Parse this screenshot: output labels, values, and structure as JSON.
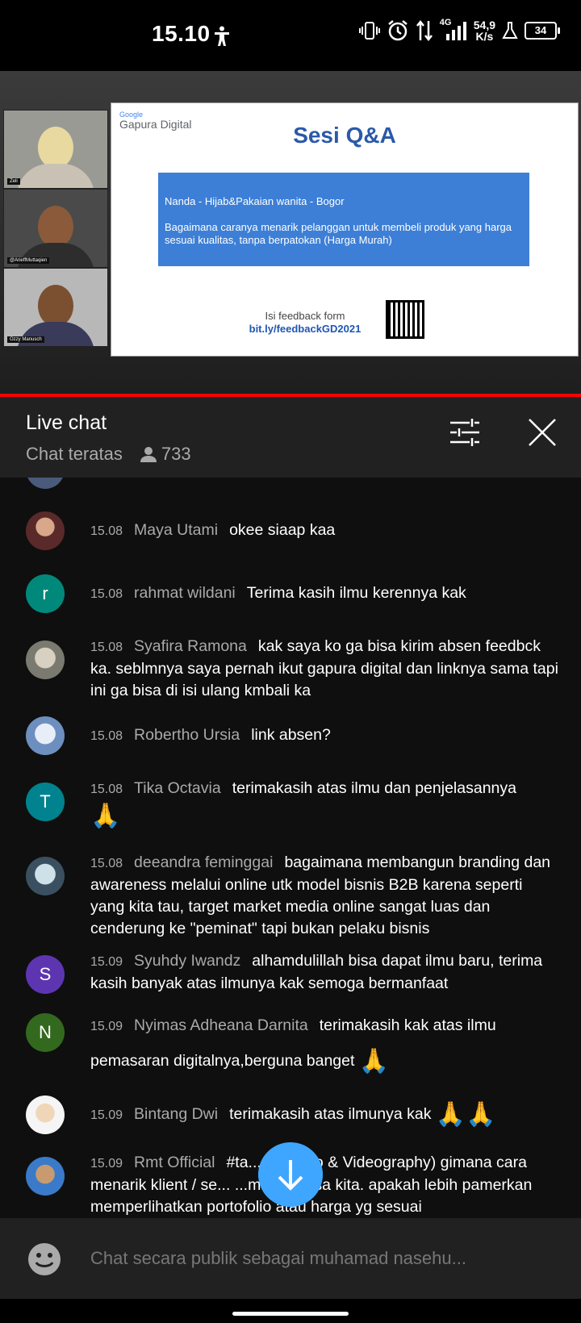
{
  "status_bar": {
    "time": "15.10",
    "network": "4G",
    "speed_value": "54,9",
    "speed_unit": "K/s",
    "battery": "34"
  },
  "video": {
    "participants": [
      "Zeli",
      "@ArieffMuttaqien",
      "Ozzy Manusch"
    ],
    "slide": {
      "brand_small": "Google",
      "brand": "Gapura Digital",
      "title": "Sesi Q&A",
      "question_name": "Nanda - Hijab&Pakaian wanita - Bogor",
      "question_text": "Bagaimana caranya menarik pelanggan untuk membeli produk yang harga sesuai kualitas, tanpa berpatokan (Harga Murah)",
      "feedback_label": "Isi feedback form",
      "feedback_link": "bit.ly/feedbackGD2021"
    }
  },
  "chat_header": {
    "title": "Live chat",
    "subtitle": "Chat teratas",
    "viewers": "733"
  },
  "messages": [
    {
      "time": "15.08",
      "author": "Maya Utami",
      "text": "okee siaap kaa",
      "avatar": ""
    },
    {
      "time": "15.08",
      "author": "rahmat wildani",
      "text": "Terima kasih ilmu kerennya kak",
      "avatar": "r"
    },
    {
      "time": "15.08",
      "author": "Syafira Ramona",
      "text": "kak saya ko ga bisa kirim absen feedbck ka. seblmnya saya pernah ikut gapura digital dan linknya sama tapi ini ga bisa di isi ulang kmbali ka",
      "avatar": ""
    },
    {
      "time": "15.08",
      "author": "Robertho Ursia",
      "text": "link absen?",
      "avatar": ""
    },
    {
      "time": "15.08",
      "author": "Tika Octavia",
      "text": "terimakasih atas ilmu dan penjelasannya",
      "avatar": "T",
      "emoji": "🙏"
    },
    {
      "time": "15.08",
      "author": "deeandra feminggai",
      "text": "bagaimana membangun branding dan awareness melalui online utk model bisnis B2B karena seperti yang kita tau, target market media online sangat luas dan cenderung ke \"peminat\" tapi bukan pelaku bisnis",
      "avatar": ""
    },
    {
      "time": "15.09",
      "author": "Syuhdy Iwandz",
      "text": "alhamdulillah bisa dapat ilmu baru, terima kasih banyak atas ilmunya kak semoga bermanfaat",
      "avatar": "S"
    },
    {
      "time": "15.09",
      "author": "Nyimas Adheana Darnita",
      "text": "terimakasih kak atas ilmu pemasaran digitalnya,berguna banget",
      "avatar": "N",
      "emoji": "🙏"
    },
    {
      "time": "15.09",
      "author": "Bintang Dwi",
      "text": "terimakasih atas ilmunya kak",
      "avatar": "",
      "emoji": "🙏🙏"
    },
    {
      "time": "15.09",
      "author": "Rmt Official",
      "text": "#ta... ...a Foto & Videography) gimana cara menarik klient / se... ...melalui jasa kita. apakah lebih pamerkan memperlihatkan portofolio atau harga yg sesuai",
      "avatar": ""
    }
  ],
  "input": {
    "placeholder": "Chat secara publik sebagai muhamad nasehu..."
  },
  "colors": {
    "accent": "#3ea6ff",
    "progress": "#ff0000",
    "avatar_r": "#00897b",
    "avatar_T": "#00838f",
    "avatar_S": "#5e35b1",
    "avatar_N": "#33691e"
  }
}
